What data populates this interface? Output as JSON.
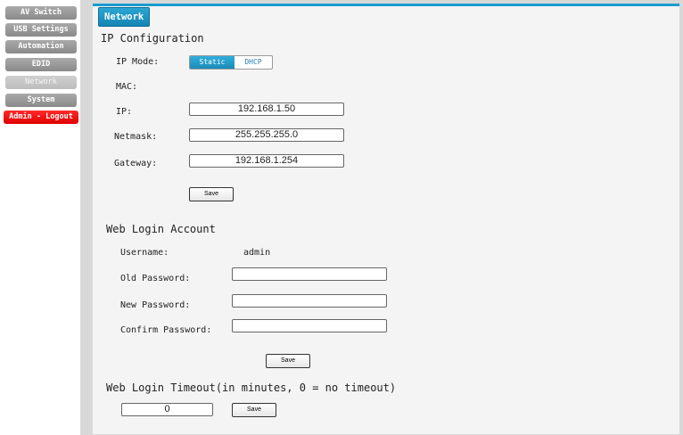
{
  "sidebar": {
    "items": [
      {
        "label": "AV Switch"
      },
      {
        "label": "USB Settings"
      },
      {
        "label": "Automation"
      },
      {
        "label": "EDID"
      },
      {
        "label": "Network"
      },
      {
        "label": "System"
      },
      {
        "label": "Admin - Logout"
      }
    ],
    "active": "Network"
  },
  "tab": {
    "label": "Network"
  },
  "ip_config": {
    "heading": "IP Configuration",
    "mode_label": "IP Mode:",
    "mode_options": [
      "Static",
      "DHCP"
    ],
    "mode_selected": "Static",
    "mac_label": "MAC:",
    "mac_value": "",
    "ip_label": "IP:",
    "ip_value": "192.168.1.50",
    "netmask_label": "Netmask:",
    "netmask_value": "255.255.255.0",
    "gateway_label": "Gateway:",
    "gateway_value": "192.168.1.254",
    "save_label": "Save"
  },
  "web_login": {
    "heading": "Web Login Account",
    "username_label": "Username:",
    "username_value": "admin",
    "old_password_label": "Old Password:",
    "new_password_label": "New Password:",
    "confirm_password_label": "Confirm Password:",
    "save_label": "Save"
  },
  "timeout": {
    "heading": "Web Login Timeout(in minutes, 0 = no timeout)",
    "value": "0",
    "save_label": "Save"
  },
  "colors": {
    "accent": "#1a9ccf",
    "logout": "#ff0000",
    "nav": "#9a9a9a"
  }
}
